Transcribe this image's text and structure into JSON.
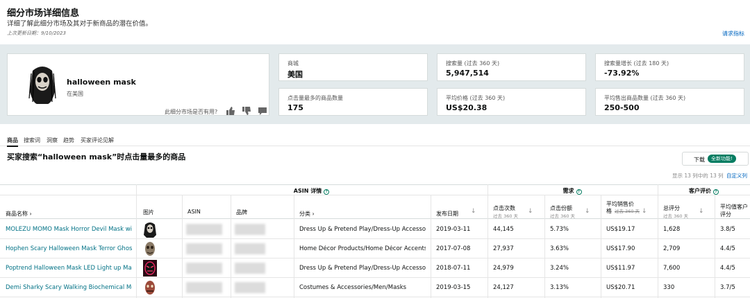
{
  "header": {
    "title": "细分市场详细信息",
    "subtitle": "详细了解此细分市场及其对于新商品的潜在价值。",
    "last_updated": "上次更新日期：9/10/2023",
    "request_link": "请求指标"
  },
  "summary": {
    "keyword": "halloween mask",
    "keyword_sub": "在美国",
    "useful_question": "此细分市场是否有用?",
    "metrics": [
      {
        "label": "商城",
        "value": "美国"
      },
      {
        "label": "搜索量 (过去 360 天)",
        "value": "5,947,514"
      },
      {
        "label": "搜索量增长 (过去 180 天)",
        "value": "-73.92%"
      },
      {
        "label": "点击量最多的商品数量",
        "value": "175"
      },
      {
        "label": "平均价格 (过去 360 天)",
        "value": "US$20.38"
      },
      {
        "label": "平均售出商品数量 (过去 360 天)",
        "value": "250-500"
      }
    ]
  },
  "tabs": [
    "商品",
    "搜索词",
    "洞察",
    "趋势",
    "买家评论见解"
  ],
  "section": {
    "title": "买家搜索“halloween mask”时点击量最多的商品",
    "download": "下载",
    "new_badge": "全新功能!",
    "count_text": "显示 13 列中的 13 列",
    "customize": "自定义列"
  },
  "table": {
    "groups": {
      "asin": "ASIN 详情",
      "demand": "需求",
      "customer": "客户评价"
    },
    "columns": {
      "name": "商品名称",
      "image": "图片",
      "asin": "ASIN",
      "brand": "品牌",
      "category": "分类",
      "launch": "发布日期",
      "clicks": "点击次数",
      "clicks_sub": "过去 360 天",
      "share": "点击份额",
      "share_sub": "过去 360 天",
      "price": "平均销售价",
      "price_line2": "格",
      "price_sub": "过去 360 天",
      "reviews": "总评分",
      "reviews_sub": "过去 360 天",
      "rating": "平均值客户",
      "rating_line2": "评分"
    },
    "rows": [
      {
        "name": "MOLEZU MOMO Mask Horror Devil Mask with Lo...",
        "category": "Dress Up & Pretend Play/Dress-Up Accessories/...",
        "launch": "2019-03-11",
        "clicks": "44,145",
        "share": "5.73%",
        "price": "US$19.17",
        "reviews": "1,628",
        "rating": "3.8/5",
        "thumb": "momo-mask-thumbnail"
      },
      {
        "name": "Hophen Scary Halloween Mask Terror Ghost Devil...",
        "category": "Home Décor Products/Home Décor Accents/Deco...",
        "launch": "2017-07-08",
        "clicks": "27,937",
        "share": "3.63%",
        "price": "US$17.90",
        "reviews": "2,709",
        "rating": "4.4/5",
        "thumb": "ghost-mask-thumbnail"
      },
      {
        "name": "Poptrend Halloween Mask LED Light up Mask for ...",
        "category": "Dress Up & Pretend Play/Dress-Up Accessories/...",
        "launch": "2018-07-11",
        "clicks": "24,979",
        "share": "3.24%",
        "price": "US$11.97",
        "reviews": "7,600",
        "rating": "4.4/5",
        "thumb": "led-mask-thumbnail"
      },
      {
        "name": "Demi Sharky Scary Walking Biochemical Monster ...",
        "category": "Costumes & Accessories/Men/Masks",
        "launch": "2019-03-15",
        "clicks": "24,127",
        "share": "3.13%",
        "price": "US$20.71",
        "reviews": "330",
        "rating": "3.7/5",
        "thumb": "monster-mask-thumbnail"
      }
    ]
  },
  "colors": {
    "link": "#007185",
    "accent": "#067d62",
    "summary_bg": "#e3eaec"
  }
}
